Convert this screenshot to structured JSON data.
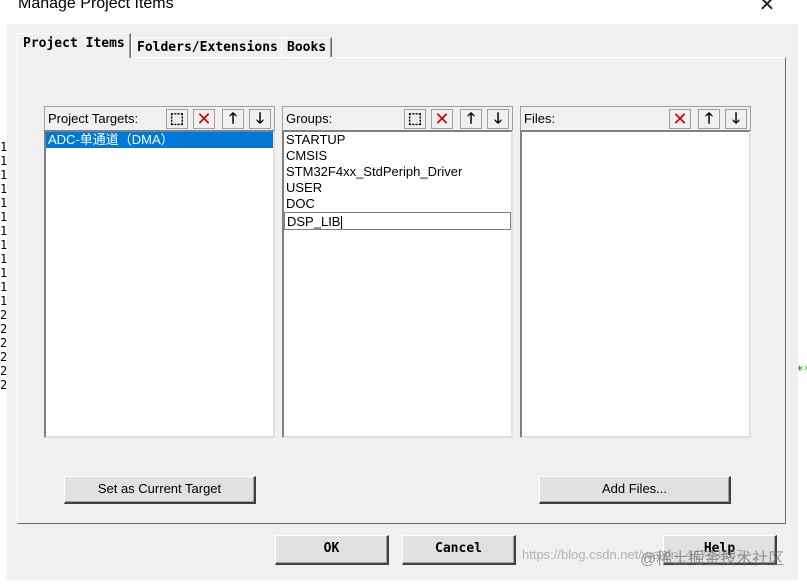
{
  "window": {
    "title": "Manage Project Items"
  },
  "tabs": [
    {
      "label": "Project Items"
    },
    {
      "label": "Folders/Extensions"
    },
    {
      "label": "Books"
    }
  ],
  "targets": {
    "label": "Project Targets:",
    "items": [
      "ADC-单通道（DMA）"
    ],
    "selected": 0,
    "button": "Set as Current Target"
  },
  "groups": {
    "label": "Groups:",
    "items": [
      "STARTUP",
      "CMSIS",
      "STM32F4xx_StdPeriph_Driver",
      "USER",
      "DOC",
      "DSP_LIB"
    ],
    "editing": 5
  },
  "files": {
    "label": "Files:",
    "items": [],
    "button": "Add Files..."
  },
  "footer": {
    "ok": "OK",
    "cancel": "Cancel",
    "help": "Help"
  },
  "background": {
    "left_digits": [
      "1",
      "1",
      "1",
      "1",
      "1",
      "1",
      "1",
      "1",
      "1",
      "1",
      "1",
      "1",
      "2",
      "2",
      "2",
      "2",
      "2",
      "2"
    ],
    "right_text": ":**"
  },
  "watermark": {
    "url": "https://blog.csdn.net/weixin_44793487",
    "brand": "@稀土掘金技术社区"
  },
  "icons": {
    "new": "new-item-icon",
    "delete": "delete-icon",
    "up": "move-up-icon",
    "down": "move-down-icon",
    "close": "close-icon"
  },
  "colors": {
    "selection": "#0078d7",
    "delete": "#d00000",
    "dialog": "#f0f0f0"
  }
}
